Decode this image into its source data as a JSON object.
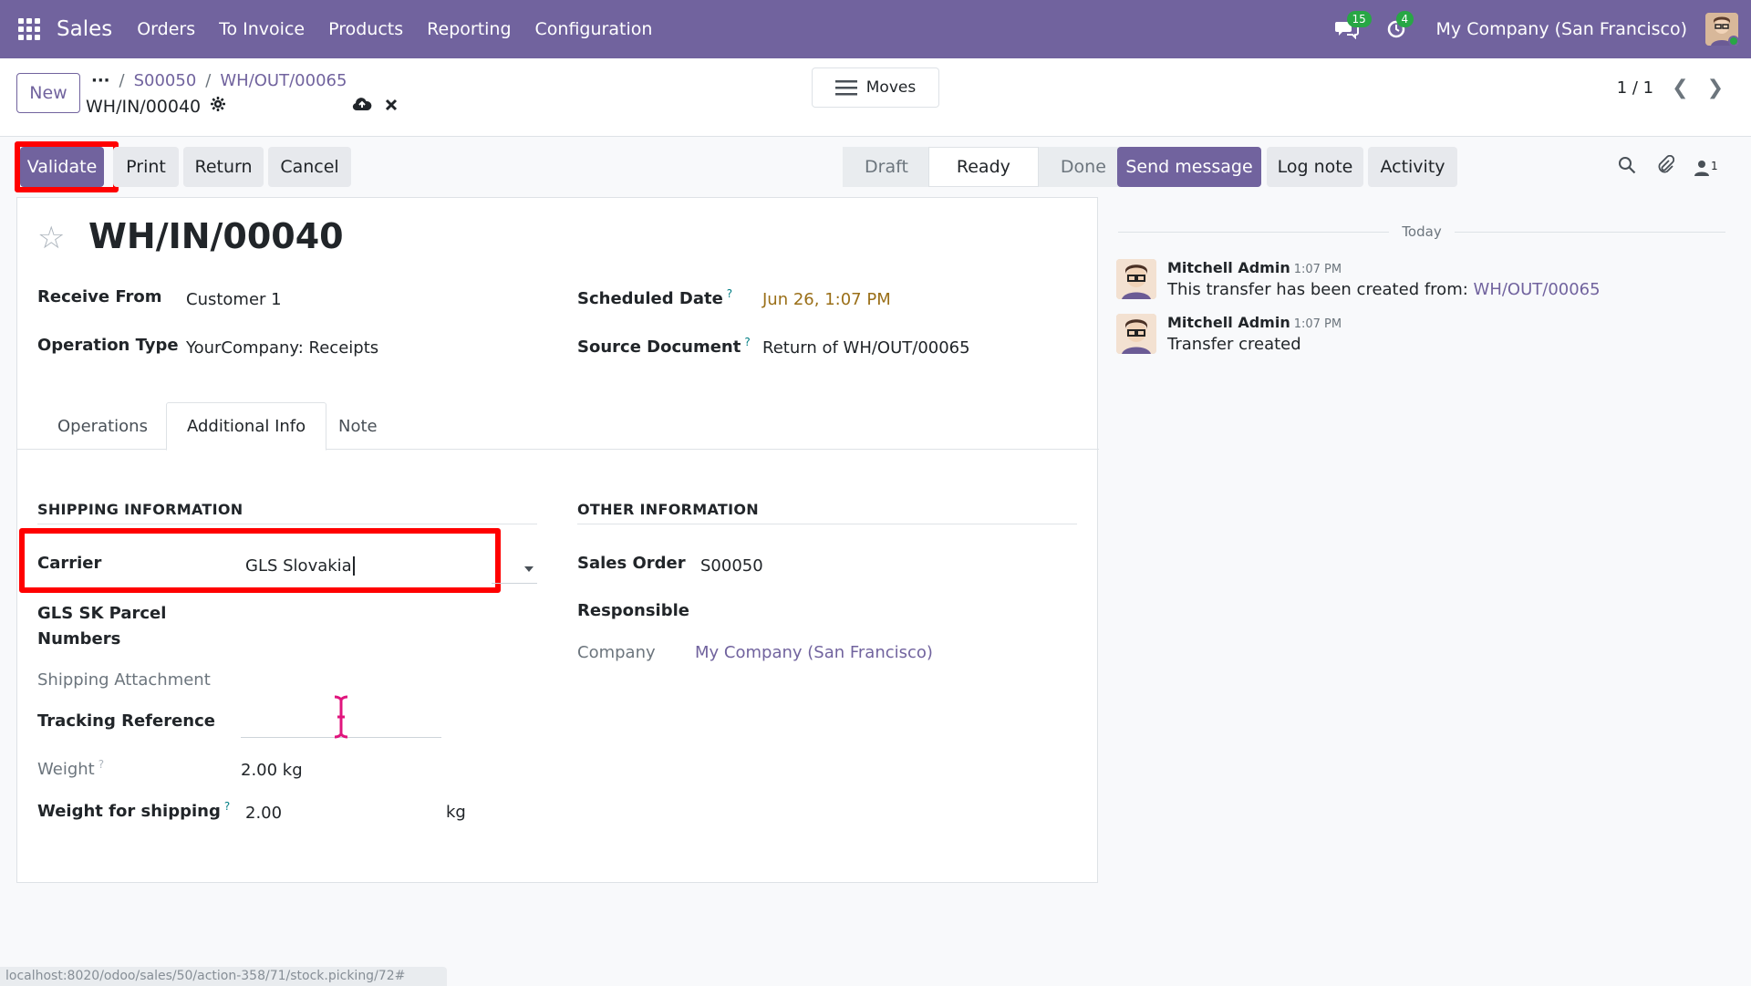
{
  "navbar": {
    "brand": "Sales",
    "menu": [
      "Orders",
      "To Invoice",
      "Products",
      "Reporting",
      "Configuration"
    ],
    "messages_count": "15",
    "activities_count": "4",
    "company": "My Company (San Francisco)"
  },
  "control": {
    "new_label": "New",
    "breadcrumb": [
      "S00050",
      "WH/OUT/00065"
    ],
    "record": "WH/IN/00040",
    "moves_label": "Moves",
    "pager": "1 / 1"
  },
  "actions": {
    "validate": "Validate",
    "print": "Print",
    "return": "Return",
    "cancel": "Cancel"
  },
  "status": [
    "Draft",
    "Ready",
    "Done"
  ],
  "status_active": "Ready",
  "form": {
    "title": "WH/IN/00040",
    "receive_from_label": "Receive From",
    "receive_from": "Customer 1",
    "operation_type_label": "Operation Type",
    "operation_type": "YourCompany: Receipts",
    "scheduled_date_label": "Scheduled Date",
    "scheduled_date": "Jun 26, 1:07 PM",
    "source_document_label": "Source Document",
    "source_document": "Return of WH/OUT/00065",
    "help": "?"
  },
  "tabs": [
    "Operations",
    "Additional Info",
    "Note"
  ],
  "shipping": {
    "title": "SHIPPING INFORMATION",
    "carrier_label": "Carrier",
    "carrier": "GLS Slovakia",
    "parcel_label_1": "GLS SK Parcel",
    "parcel_label_2": "Numbers",
    "attachment_label": "Shipping Attachment",
    "tracking_label": "Tracking Reference",
    "weight_label": "Weight",
    "weight": "2.00 kg",
    "weight_shipping_label": "Weight for shipping",
    "weight_shipping": "2.00",
    "weight_shipping_unit": "kg"
  },
  "other": {
    "title": "OTHER INFORMATION",
    "sales_order_label": "Sales Order",
    "sales_order": "S00050",
    "responsible_label": "Responsible",
    "company_label": "Company",
    "company": "My Company (San Francisco)"
  },
  "chatter": {
    "send_message": "Send message",
    "log_note": "Log note",
    "activity": "Activity",
    "followers": "1",
    "today": "Today",
    "messages": [
      {
        "author": "Mitchell Admin",
        "time": "1:07 PM",
        "text": "This transfer has been created from: ",
        "link": "WH/OUT/00065"
      },
      {
        "author": "Mitchell Admin",
        "time": "1:07 PM",
        "text": "Transfer created",
        "link": ""
      }
    ]
  },
  "statusbar_url": "localhost:8020/odoo/sales/50/action-358/71/stock.picking/72#",
  "colors": {
    "brand": "#71639e",
    "highlight": "#ff0000",
    "date": "#9a6f18"
  }
}
